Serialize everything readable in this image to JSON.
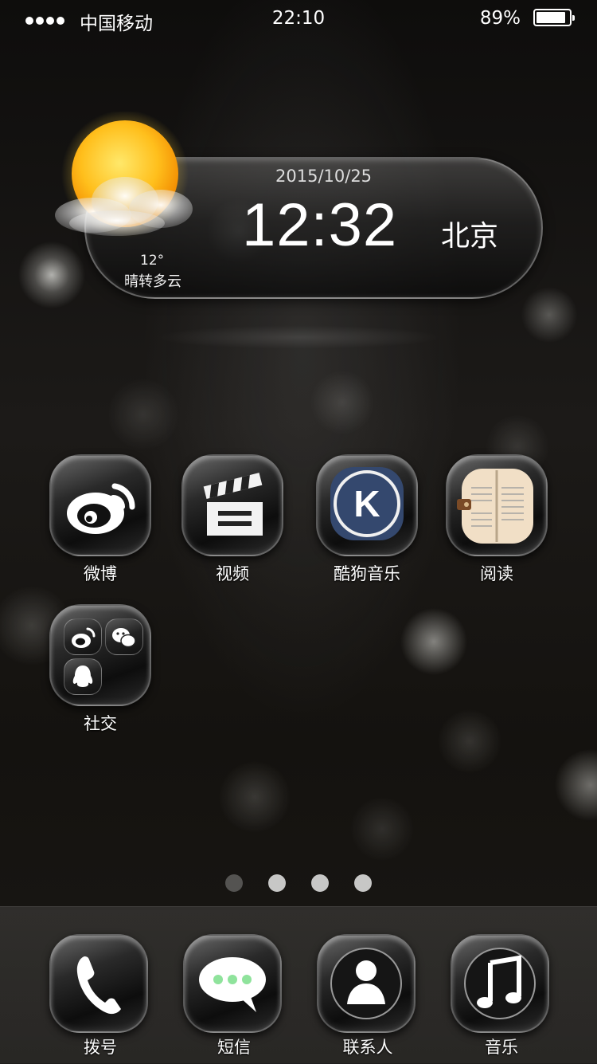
{
  "status_bar": {
    "carrier": "中国移动",
    "time": "22:10",
    "battery_percent": "89%",
    "battery_level": 0.89,
    "signal_bars": 4
  },
  "weather_widget": {
    "date": "2015/10/25",
    "time": "12:32",
    "city": "北京",
    "temperature": "12°",
    "condition": "晴转多云",
    "icon": "sun-cloud-icon"
  },
  "apps": [
    {
      "label": "微博",
      "icon": "weibo-icon"
    },
    {
      "label": "视频",
      "icon": "clapperboard-icon"
    },
    {
      "label": "酷狗音乐",
      "icon": "kugou-icon"
    },
    {
      "label": "阅读",
      "icon": "book-icon"
    }
  ],
  "folder": {
    "label": "社交",
    "contents": [
      "weibo-icon",
      "wechat-icon",
      "qq-icon"
    ]
  },
  "page_indicator": {
    "count": 4,
    "current": 1
  },
  "dock": [
    {
      "label": "拨号",
      "icon": "phone-icon"
    },
    {
      "label": "短信",
      "icon": "message-icon"
    },
    {
      "label": "联系人",
      "icon": "contacts-icon"
    },
    {
      "label": "音乐",
      "icon": "music-note-icon"
    }
  ],
  "colors": {
    "kugou_blue": "#34486e",
    "book_paper": "#f1dfc6",
    "message_green": "#8fe39c"
  }
}
